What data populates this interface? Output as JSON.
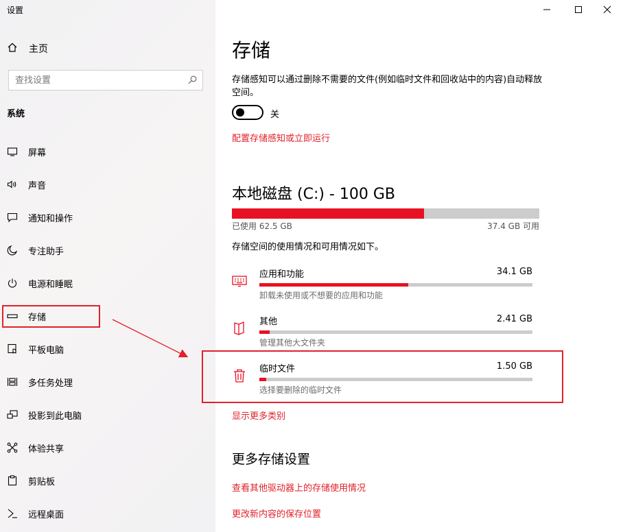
{
  "window": {
    "title": "设置"
  },
  "sidebar": {
    "home_label": "主页",
    "search_placeholder": "查找设置",
    "section_title": "系统",
    "items": [
      {
        "label": "屏幕",
        "icon": "monitor-icon"
      },
      {
        "label": "声音",
        "icon": "speaker-icon"
      },
      {
        "label": "通知和操作",
        "icon": "notification-icon"
      },
      {
        "label": "专注助手",
        "icon": "moon-icon"
      },
      {
        "label": "电源和睡眠",
        "icon": "power-icon"
      },
      {
        "label": "存储",
        "icon": "storage-icon"
      },
      {
        "label": "平板电脑",
        "icon": "tablet-icon"
      },
      {
        "label": "多任务处理",
        "icon": "multitask-icon"
      },
      {
        "label": "投影到此电脑",
        "icon": "project-icon"
      },
      {
        "label": "体验共享",
        "icon": "share-icon"
      },
      {
        "label": "剪贴板",
        "icon": "clipboard-icon"
      },
      {
        "label": "远程桌面",
        "icon": "remote-desktop-icon"
      }
    ]
  },
  "main": {
    "title": "存储",
    "storage_sense_desc": "存储感知可以通过删除不需要的文件(例如临时文件和回收站中的内容)自动释放空间。",
    "toggle_label": "关",
    "toggle_on": false,
    "configure_link": "配置存储感知或立即运行",
    "disk_title": "本地磁盘 (C:) - 100 GB",
    "disk_used_fraction": 0.625,
    "used_label": "已使用 62.5 GB",
    "free_label": "37.4 GB 可用",
    "usage_info": "存储空间的使用情况和可用情况如下。",
    "categories": [
      {
        "name": "应用和功能",
        "size": "34.1 GB",
        "desc": "卸载未使用或不想要的应用和功能",
        "fraction": 0.545,
        "icon": "keyboard-icon"
      },
      {
        "name": "其他",
        "size": "2.41 GB",
        "desc": "管理其他大文件夹",
        "fraction": 0.038,
        "icon": "folder-icon"
      },
      {
        "name": "临时文件",
        "size": "1.50 GB",
        "desc": "选择要删除的临时文件",
        "fraction": 0.024,
        "icon": "trash-icon"
      }
    ],
    "show_more_link": "显示更多类别",
    "more_settings_title": "更多存储设置",
    "other_drives_link": "查看其他驱动器上的存储使用情况",
    "save_location_link": "更改新内容的保存位置"
  },
  "colors": {
    "accent": "#e81123",
    "annotation": "#e0212a",
    "link": "#e0212a"
  }
}
